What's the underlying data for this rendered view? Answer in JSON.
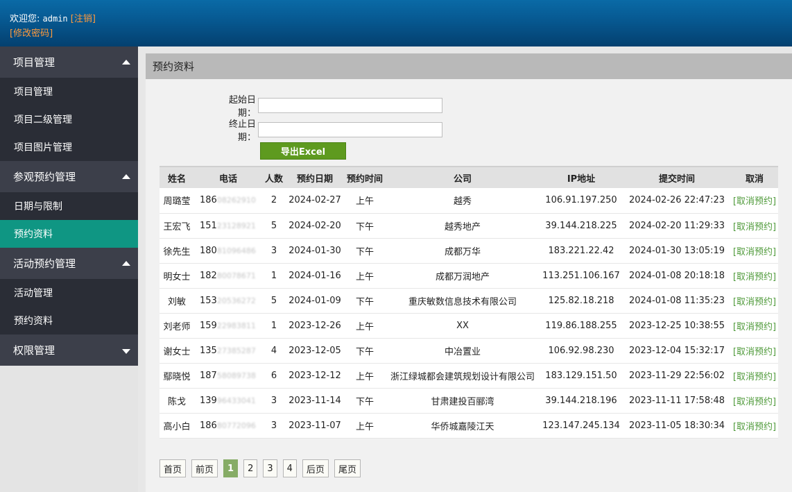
{
  "header": {
    "welcome_label": "欢迎您:",
    "username": "admin",
    "logout_label": "[注销]",
    "change_password_label": "[修改密码]"
  },
  "sidebar": {
    "groups": [
      {
        "title": "项目管理",
        "expanded": true,
        "items": [
          "项目管理",
          "项目二级管理",
          "项目图片管理"
        ]
      },
      {
        "title": "参观预约管理",
        "expanded": true,
        "items": [
          "日期与限制",
          "预约资料"
        ]
      },
      {
        "title": "活动预约管理",
        "expanded": true,
        "items": [
          "活动管理",
          "预约资料"
        ]
      },
      {
        "title": "权限管理",
        "expanded": false,
        "items": []
      }
    ],
    "active_item": "预约资料"
  },
  "panel": {
    "title": "预约资料",
    "start_date_label": "起始日期：",
    "end_date_label": "终止日期：",
    "start_date_value": "",
    "end_date_value": "",
    "export_label": "导出Excel"
  },
  "table": {
    "columns": [
      "姓名",
      "电话",
      "人数",
      "预约日期",
      "预约时间",
      "公司",
      "IP地址",
      "提交时间",
      "取消"
    ],
    "rows": [
      {
        "name": "周璐莹",
        "phone_prefix": "186",
        "phone_rest": "08262910",
        "people": "2",
        "date": "2024-02-27",
        "time": "上午",
        "company": "越秀",
        "ip": "106.91.197.250",
        "submitted": "2024-02-26 22:47:23",
        "cancel": "[取消预约]"
      },
      {
        "name": "王宏飞",
        "phone_prefix": "151",
        "phone_rest": "23128921",
        "people": "5",
        "date": "2024-02-20",
        "time": "下午",
        "company": "越秀地产",
        "ip": "39.144.218.225",
        "submitted": "2024-02-20 11:29:33",
        "cancel": "[取消预约]"
      },
      {
        "name": "徐先生",
        "phone_prefix": "180",
        "phone_rest": "81096486",
        "people": "3",
        "date": "2024-01-30",
        "time": "下午",
        "company": "成都万华",
        "ip": "183.221.22.42",
        "submitted": "2024-01-30 13:05:19",
        "cancel": "[取消预约]"
      },
      {
        "name": "明女士",
        "phone_prefix": "182",
        "phone_rest": "80078671",
        "people": "1",
        "date": "2024-01-16",
        "time": "上午",
        "company": "成都万润地产",
        "ip": "113.251.106.167",
        "submitted": "2024-01-08 20:18:18",
        "cancel": "[取消预约]"
      },
      {
        "name": "刘敏",
        "phone_prefix": "153",
        "phone_rest": "20536272",
        "people": "5",
        "date": "2024-01-09",
        "time": "下午",
        "company": "重庆敏数信息技术有限公司",
        "ip": "125.82.18.218",
        "submitted": "2024-01-08 11:35:23",
        "cancel": "[取消预约]"
      },
      {
        "name": "刘老师",
        "phone_prefix": "159",
        "phone_rest": "22983811",
        "people": "1",
        "date": "2023-12-26",
        "time": "上午",
        "company": "XX",
        "ip": "119.86.188.255",
        "submitted": "2023-12-25 10:38:55",
        "cancel": "[取消预约]"
      },
      {
        "name": "谢女士",
        "phone_prefix": "135",
        "phone_rest": "27385287",
        "people": "4",
        "date": "2023-12-05",
        "time": "下午",
        "company": "中冶置业",
        "ip": "106.92.98.230",
        "submitted": "2023-12-04 15:32:17",
        "cancel": "[取消预约]"
      },
      {
        "name": "鄢晓悦",
        "phone_prefix": "187",
        "phone_rest": "58089738",
        "people": "6",
        "date": "2023-12-12",
        "time": "上午",
        "company": "浙江绿城都会建筑规划设计有限公司",
        "ip": "183.129.151.50",
        "submitted": "2023-11-29 22:56:02",
        "cancel": "[取消预约]"
      },
      {
        "name": "陈戈",
        "phone_prefix": "139",
        "phone_rest": "96433041",
        "people": "3",
        "date": "2023-11-14",
        "time": "下午",
        "company": "甘肃建投百郦湾",
        "ip": "39.144.218.196",
        "submitted": "2023-11-11 17:58:48",
        "cancel": "[取消预约]"
      },
      {
        "name": "高小白",
        "phone_prefix": "186",
        "phone_rest": "80772096",
        "people": "3",
        "date": "2023-11-07",
        "time": "上午",
        "company": "华侨城嘉陵江天",
        "ip": "123.147.245.134",
        "submitted": "2023-11-05 18:30:34",
        "cancel": "[取消预约]"
      }
    ]
  },
  "pager": {
    "first": "首页",
    "prev": "前页",
    "pages": [
      "1",
      "2",
      "3",
      "4"
    ],
    "current": "1",
    "next": "后页",
    "last": "尾页"
  },
  "colors": {
    "header_top": "#0a6aa6",
    "header_bottom": "#04406f",
    "sidebar_group": "#3c3f4a",
    "sidebar_item": "#2a2d36",
    "sidebar_active": "#0f9683",
    "export_button": "#5e9a1f",
    "cancel_link": "#4f9a3a",
    "pager_current": "#86ac66",
    "link_orange": "#ff9a3d"
  }
}
